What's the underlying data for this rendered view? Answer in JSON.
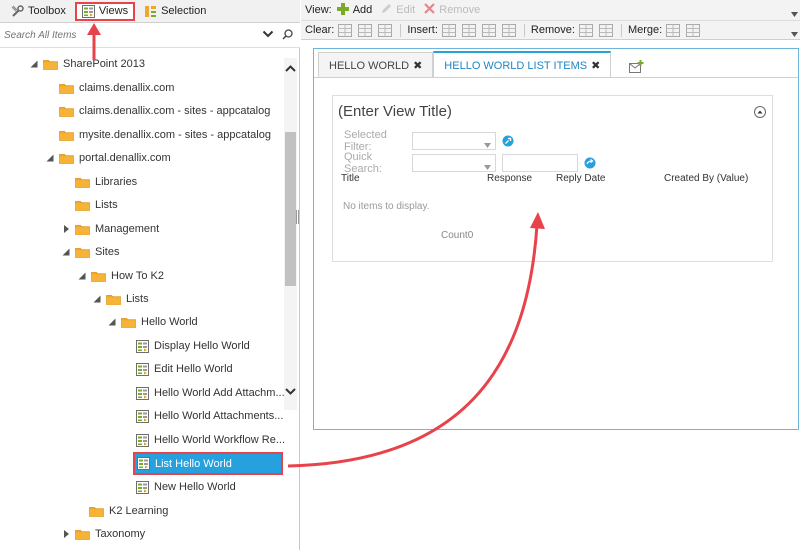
{
  "left_tabs": [
    {
      "label": "Toolbox",
      "icon": "tools-icon"
    },
    {
      "label": "Views",
      "icon": "view-icon"
    },
    {
      "label": "Selection",
      "icon": "selection-icon"
    }
  ],
  "search": {
    "placeholder": "Search All Items"
  },
  "tree": {
    "root": "SharePoint 2013",
    "n1": "claims.denallix.com",
    "n2": "claims.denallix.com - sites - appcatalog",
    "n3": "mysite.denallix.com - sites - appcatalog",
    "n4": "portal.denallix.com",
    "n5": "Libraries",
    "n6": "Lists",
    "n7": "Management",
    "n8": "Sites",
    "n9": "How To K2",
    "n10": "Lists",
    "n11": "Hello World",
    "v1": "Display Hello World",
    "v2": "Edit Hello World",
    "v3": "Hello World Add Attachm...",
    "v4": "Hello World Attachments...",
    "v5": "Hello World Workflow Re...",
    "v6": "List Hello World",
    "v7": "New Hello World",
    "n12": "K2 Learning",
    "n13": "Taxonomy"
  },
  "toolbar1": {
    "view_label": "View:",
    "add": "Add",
    "edit": "Edit",
    "remove": "Remove"
  },
  "toolbar2": {
    "clear": "Clear:",
    "insert": "Insert:",
    "remove": "Remove:",
    "merge": "Merge:"
  },
  "view_tabs": [
    {
      "label": "HELLO WORLD",
      "close": "✖",
      "active": false
    },
    {
      "label": "HELLO WORLD LIST ITEMS",
      "close": "✖",
      "active": true
    }
  ],
  "form": {
    "title": "(Enter View Title)",
    "selected_filter": "Selected Filter:",
    "quick_search": "Quick Search:",
    "columns": [
      "Title",
      "Response",
      "Reply Date",
      "Created By (Value)"
    ],
    "no_items": "No items to display.",
    "count_label": "Count",
    "count_value": "0"
  },
  "colors": {
    "accent": "#27a0de",
    "annotation": "#e8424a",
    "folder": "#f0a829"
  }
}
